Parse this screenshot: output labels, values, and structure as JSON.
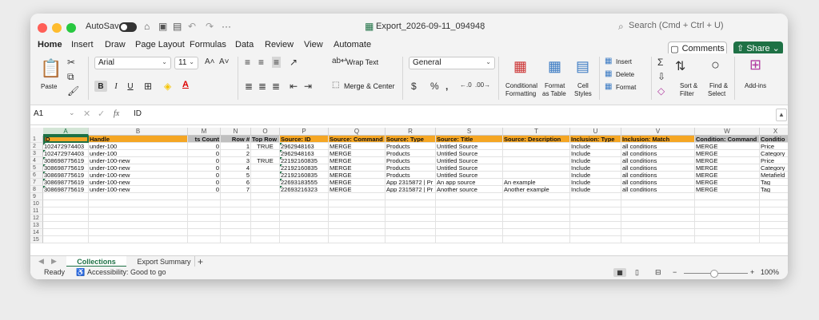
{
  "titlebar": {
    "autosave_label": "AutoSave",
    "doc_title": "Export_2026-09-11_094948",
    "search_placeholder": "Search (Cmd + Ctrl + U)"
  },
  "ribbon_tabs": [
    "Home",
    "Insert",
    "Draw",
    "Page Layout",
    "Formulas",
    "Data",
    "Review",
    "View",
    "Automate"
  ],
  "active_tab": "Home",
  "buttons": {
    "comments": "Comments",
    "share": "Share"
  },
  "ribbon": {
    "paste": "Paste",
    "font_name": "Arial",
    "font_size": "11",
    "wrap_text": "Wrap Text",
    "merge_center": "Merge & Center",
    "number_format": "General",
    "conditional_formatting": [
      "Conditional",
      "Formatting"
    ],
    "format_as_table": [
      "Format",
      "as Table"
    ],
    "cell_styles": [
      "Cell",
      "Styles"
    ],
    "insert": "Insert",
    "delete": "Delete",
    "format": "Format",
    "sort_filter": [
      "Sort &",
      "Filter"
    ],
    "find_select": [
      "Find &",
      "Select"
    ],
    "add_ins": "Add-ins"
  },
  "formula_bar": {
    "cell_ref": "A1",
    "fx": "fx",
    "content": "ID"
  },
  "grid": {
    "column_letters": [
      "A",
      "B",
      "M",
      "N",
      "O",
      "P",
      "Q",
      "R",
      "S",
      "T",
      "U",
      "V",
      "W",
      "X"
    ],
    "header_row": [
      "ID",
      "Handle",
      "ts Count",
      "Row #",
      "Top Row",
      "Source: ID",
      "Source: Command",
      "Source: Type",
      "Source: Title",
      "Source: Description",
      "Inclusion: Type",
      "Inclusion: Match",
      "Condition: Command",
      "Conditio"
    ],
    "rows": [
      [
        "102472974403",
        "under-100",
        "0",
        "1",
        "TRUE",
        "2962948163",
        "MERGE",
        "Products",
        "Untitled Source",
        "",
        "Include",
        "all conditions",
        "MERGE",
        "Price"
      ],
      [
        "102472974403",
        "under-100",
        "0",
        "2",
        "",
        "2962948163",
        "MERGE",
        "Products",
        "Untitled Source",
        "",
        "Include",
        "all conditions",
        "MERGE",
        "Category"
      ],
      [
        "308698775619",
        "under-100-new",
        "0",
        "3",
        "TRUE",
        "22192160835",
        "MERGE",
        "Products",
        "Untitled Source",
        "",
        "Include",
        "all conditions",
        "MERGE",
        "Price"
      ],
      [
        "308698775619",
        "under-100-new",
        "0",
        "4",
        "",
        "22192160835",
        "MERGE",
        "Products",
        "Untitled Source",
        "",
        "Include",
        "all conditions",
        "MERGE",
        "Category"
      ],
      [
        "308698775619",
        "under-100-new",
        "0",
        "5",
        "",
        "22192160835",
        "MERGE",
        "Products",
        "Untitled Source",
        "",
        "Include",
        "all conditions",
        "MERGE",
        "Metafield"
      ],
      [
        "308698775619",
        "under-100-new",
        "0",
        "6",
        "",
        "22693183555",
        "MERGE",
        "App 2315872 | Pr",
        "An app source",
        "An example",
        "Include",
        "all conditions",
        "MERGE",
        "Tag"
      ],
      [
        "308698775619",
        "under-100-new",
        "0",
        "7",
        "",
        "22693216323",
        "MERGE",
        "App 2315872 | Pr",
        "Another source",
        "Another example",
        "Include",
        "all conditions",
        "MERGE",
        "Tag"
      ]
    ],
    "row_numbers": [
      "1",
      "2",
      "3",
      "4",
      "5",
      "6",
      "7",
      "8",
      "9",
      "10",
      "11",
      "12",
      "13",
      "14",
      "15"
    ]
  },
  "sheets": [
    "Collections",
    "Export Summary"
  ],
  "active_sheet": "Collections",
  "statusbar": {
    "ready": "Ready",
    "accessibility": "Accessibility: Good to go",
    "zoom": "100%"
  },
  "colors": {
    "accent": "#1e7145",
    "header_fill": "#f5a623"
  }
}
